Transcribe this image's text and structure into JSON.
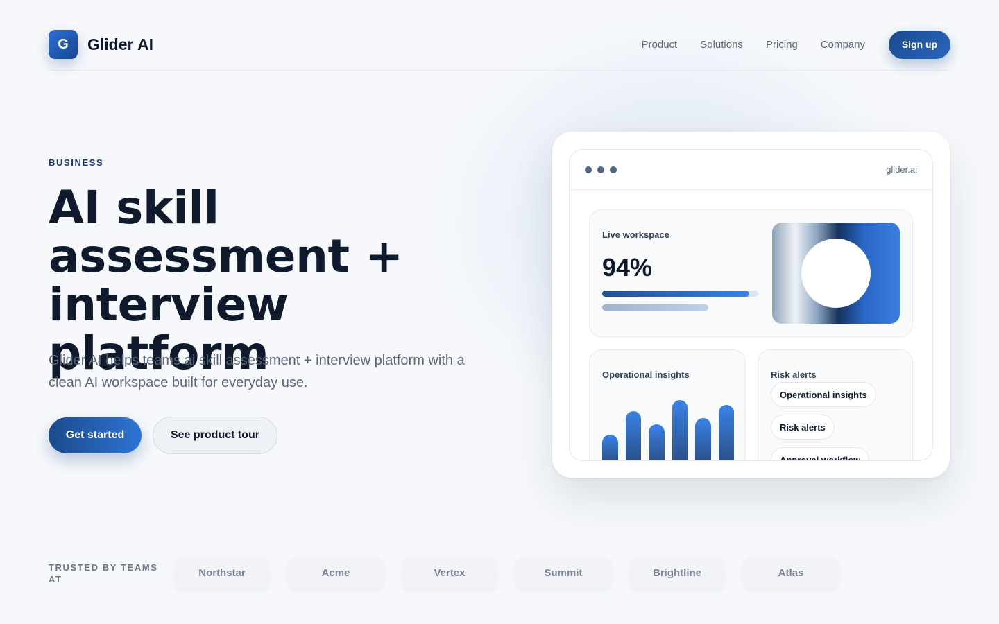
{
  "brand": {
    "logo_letter": "G",
    "name": "Glider AI"
  },
  "nav": {
    "items": [
      {
        "label": "Product"
      },
      {
        "label": "Solutions"
      },
      {
        "label": "Pricing"
      },
      {
        "label": "Company"
      }
    ],
    "signup_label": "Sign up"
  },
  "hero": {
    "eyebrow": "BUSINESS",
    "headline": "AI skill assessment + interview platform",
    "subtitle": "Glider AI helps teams ai skill assessment + interview platform with a clean AI workspace built for everyday use.",
    "primary_cta": "Get started",
    "secondary_cta": "See product tour"
  },
  "mockup": {
    "url": "glider.ai",
    "live_card": {
      "label": "Live workspace",
      "value": "94%",
      "progress": 0.94
    },
    "ops_card": {
      "label": "Operational insights",
      "bar_values": [
        0.44,
        0.8,
        0.6,
        0.98,
        0.7,
        0.9
      ]
    },
    "risk_card": {
      "label": "Risk alerts",
      "pills": [
        "Operational insights",
        "Risk alerts",
        "Approval workflow"
      ]
    }
  },
  "trusted": {
    "label": "TRUSTED BY TEAMS AT",
    "logos": [
      "Northstar",
      "Acme",
      "Vertex",
      "Summit",
      "Brightline",
      "Atlas"
    ]
  },
  "colors": {
    "accent": "#1a4a8c",
    "accent_light": "#2f74d4",
    "text": "#0f1b2d",
    "muted": "#5a6778"
  }
}
